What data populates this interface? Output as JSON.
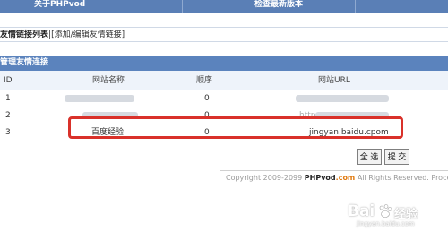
{
  "top_bar": {
    "about_label": "关于PHPvod",
    "check_label": "检查最新版本"
  },
  "subnav": {
    "current": "友情链接列表",
    "separator": "|",
    "add_link": "[添加/编辑友情链接]"
  },
  "panel": {
    "title": "管理友情连接",
    "columns": [
      "ID",
      "网站名称",
      "顺序",
      "网站URL"
    ],
    "rows": [
      {
        "id": "1",
        "name": "",
        "order": "0",
        "url": ""
      },
      {
        "id": "2",
        "name": "",
        "order": "0",
        "url": "http"
      },
      {
        "id": "3",
        "name": "百度经验",
        "order": "0",
        "url": "jingyan.baidu.cpom"
      }
    ]
  },
  "buttons": {
    "select_all": "全 选",
    "submit": "提 交"
  },
  "footer": {
    "copyright_prefix": "Copyright 2009-2099",
    "brand": "PHPvod",
    "brand_suffix": ".com",
    "rights": "All Rights Reserved. Proce"
  },
  "watermark": {
    "logo": "Bai",
    "logo_suffix": "经验",
    "url": "jingyan.baidu.com"
  },
  "colors": {
    "header_bg": "#5a7fb6",
    "panel_title_bg": "#5b83bd",
    "table_head_bg": "#eef3fa",
    "highlight": "#d9312a",
    "brand_accent": "#e07a10"
  }
}
